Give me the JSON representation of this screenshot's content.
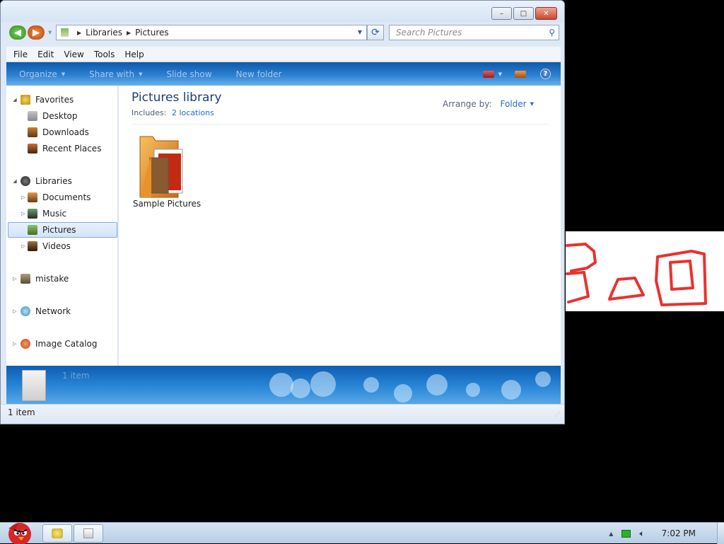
{
  "window": {
    "caption": {
      "minimize": "–",
      "maximize": "□",
      "close": "✕"
    }
  },
  "address": {
    "crumbs": [
      "Libraries",
      "Pictures"
    ],
    "search_placeholder": "Search Pictures"
  },
  "menu": [
    "File",
    "Edit",
    "View",
    "Tools",
    "Help"
  ],
  "command_bar": {
    "organize": "Organize",
    "share_with": "Share with",
    "slide_show": "Slide show",
    "new_folder": "New folder",
    "help": "?"
  },
  "nav_pane": {
    "favorites": {
      "label": "Favorites",
      "items": [
        "Desktop",
        "Downloads",
        "Recent Places"
      ]
    },
    "libraries": {
      "label": "Libraries",
      "items": [
        "Documents",
        "Music",
        "Pictures",
        "Videos"
      ],
      "selected": "Pictures"
    },
    "other": [
      "mistake",
      "Network",
      "Image Catalog"
    ]
  },
  "content": {
    "title": "Pictures library",
    "includes_label": "Includes:",
    "includes_link": "2 locations",
    "arrange_label": "Arrange by:",
    "arrange_value": "Folder",
    "items": [
      {
        "label": "Sample Pictures"
      }
    ]
  },
  "details_pane": {
    "text": "1 item"
  },
  "status_bar": {
    "text": "1 item"
  },
  "taskbar": {
    "clock": "7:02 PM"
  },
  "colors": {
    "accent": "#2a6bc2",
    "title": "#1e3f73",
    "command_bar": "#1b6cc0"
  }
}
